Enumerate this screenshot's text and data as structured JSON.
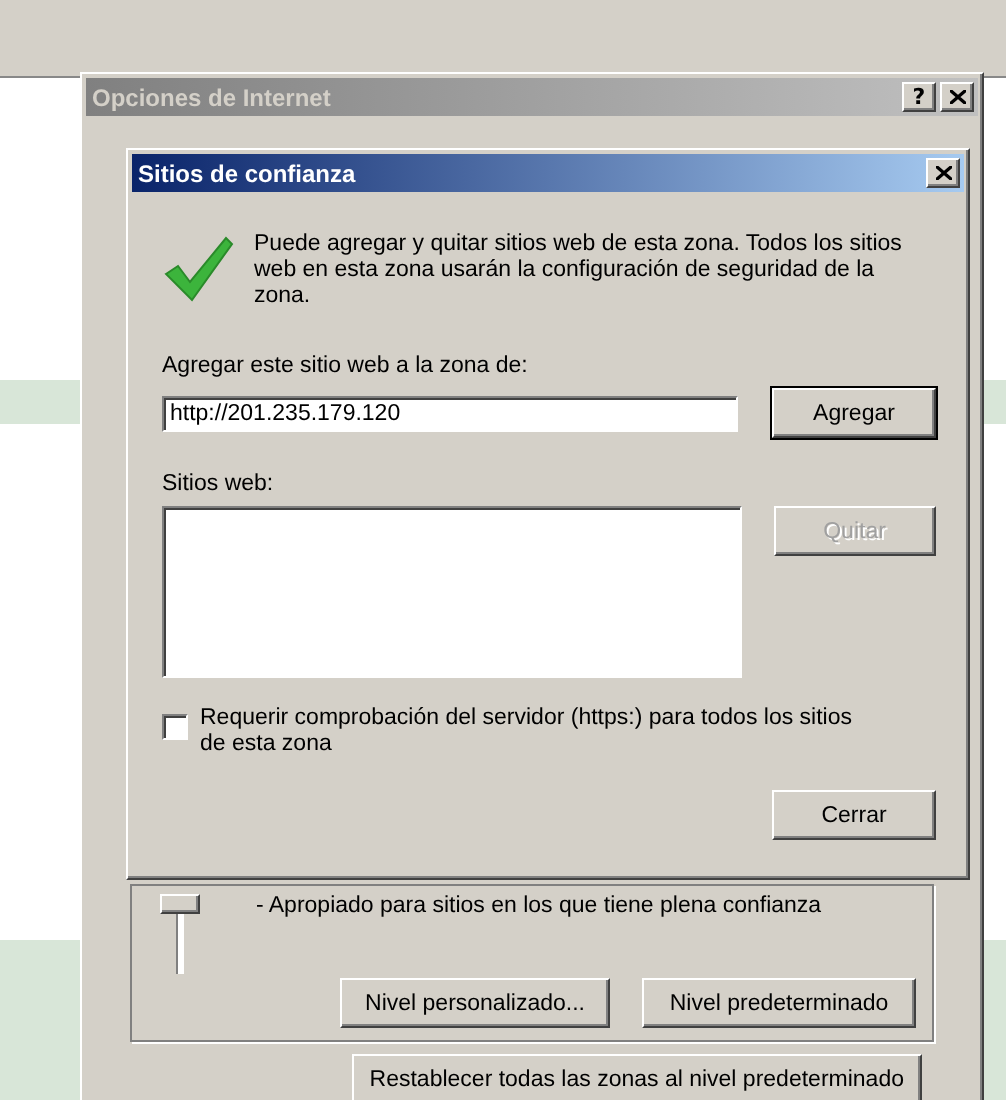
{
  "outer_window": {
    "title": "Opciones de Internet",
    "active": false,
    "help": "?",
    "zone_text": "- Apropiado para sitios en los que tiene plena confianza",
    "slider": {
      "level": 1
    },
    "buttons": [
      {
        "label": "Nivel personalizado..."
      },
      {
        "label": "Nivel predeterminado"
      }
    ],
    "reset_button": "Restablecer todas las zonas al nivel predeterminado"
  },
  "dialog": {
    "title": "Sitios de confianza",
    "active": true,
    "description": "Puede agregar y quitar sitios web de esta zona. Todos los sitios web en esta zona usarán la configuración de seguridad de la zona.",
    "add_label": "Agregar este sitio web a la zona de:",
    "add_value": "http://201.235.179.120",
    "add_button": {
      "label": "Agregar",
      "disabled": false,
      "default": true
    },
    "sites_label": "Sitios web:",
    "remove_button": {
      "label": "Quitar",
      "disabled": true
    },
    "https_check": {
      "label": "Requerir comprobación del servidor (https:) para todos los sitios de esta zona",
      "checked": false
    },
    "close_button": {
      "label": "Cerrar",
      "disabled": false
    }
  }
}
